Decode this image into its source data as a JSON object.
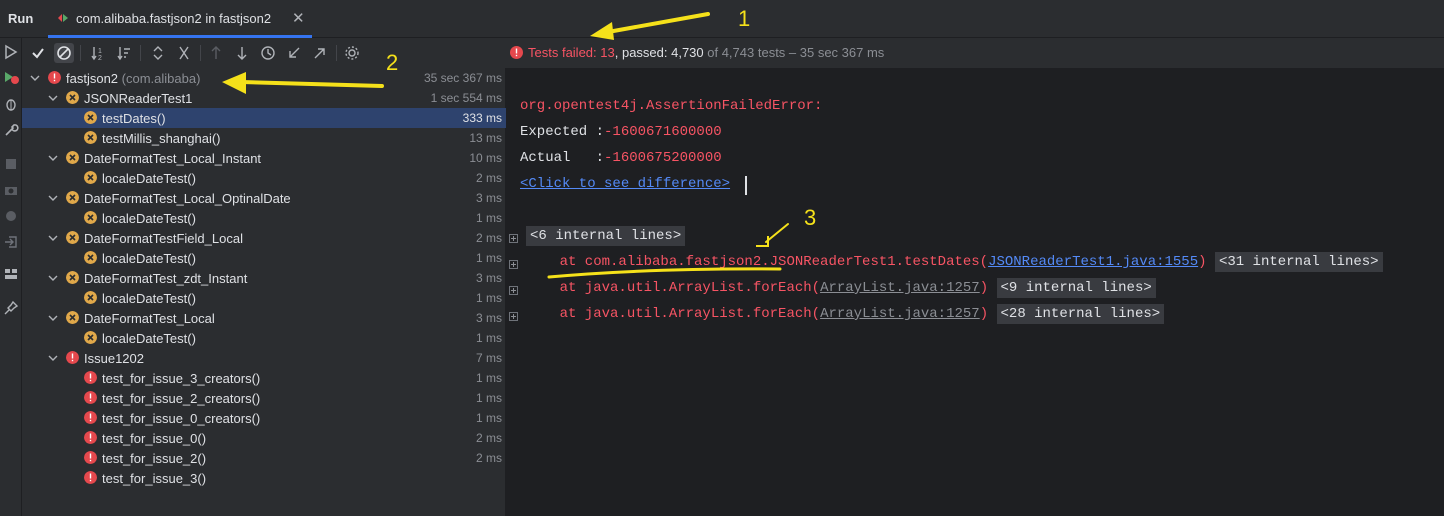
{
  "run_panel": {
    "title": "Run",
    "tab_label": "com.alibaba.fastjson2 in fastjson2"
  },
  "status": {
    "failed_label": "Tests failed: ",
    "failed_count": "13",
    "passed_label": ", passed: 4,730",
    "rest": " of 4,743 tests – 35 sec 367 ms"
  },
  "tree": [
    {
      "name": "fastjson2",
      "pkg": "(com.alibaba)",
      "time": "35 sec 367 ms",
      "status": "fail",
      "level": 0
    },
    {
      "name": "JSONReaderTest1",
      "time": "1 sec 554 ms",
      "status": "warn",
      "level": 1
    },
    {
      "name": "testDates()",
      "time": "333 ms",
      "status": "warn",
      "level": 2,
      "selected": true
    },
    {
      "name": "testMillis_shanghai()",
      "time": "13 ms",
      "status": "warn",
      "level": 2
    },
    {
      "name": "DateFormatTest_Local_Instant",
      "time": "10 ms",
      "status": "warn",
      "level": 1
    },
    {
      "name": "localeDateTest()",
      "time": "2 ms",
      "status": "warn",
      "level": 2
    },
    {
      "name": "DateFormatTest_Local_OptinalDate",
      "time": "3 ms",
      "status": "warn",
      "level": 1
    },
    {
      "name": "localeDateTest()",
      "time": "1 ms",
      "status": "warn",
      "level": 2
    },
    {
      "name": "DateFormatTestField_Local",
      "time": "2 ms",
      "status": "warn",
      "level": 1
    },
    {
      "name": "localeDateTest()",
      "time": "1 ms",
      "status": "warn",
      "level": 2
    },
    {
      "name": "DateFormatTest_zdt_Instant",
      "time": "3 ms",
      "status": "warn",
      "level": 1
    },
    {
      "name": "localeDateTest()",
      "time": "1 ms",
      "status": "warn",
      "level": 2
    },
    {
      "name": "DateFormatTest_Local",
      "time": "3 ms",
      "status": "warn",
      "level": 1
    },
    {
      "name": "localeDateTest()",
      "time": "1 ms",
      "status": "warn",
      "level": 2
    },
    {
      "name": "Issue1202",
      "time": "7 ms",
      "status": "fail",
      "level": 1
    },
    {
      "name": "test_for_issue_3_creators()",
      "time": "1 ms",
      "status": "fail",
      "level": 2
    },
    {
      "name": "test_for_issue_2_creators()",
      "time": "1 ms",
      "status": "fail",
      "level": 2
    },
    {
      "name": "test_for_issue_0_creators()",
      "time": "1 ms",
      "status": "fail",
      "level": 2
    },
    {
      "name": "test_for_issue_0()",
      "time": "2 ms",
      "status": "fail",
      "level": 2
    },
    {
      "name": "test_for_issue_2()",
      "time": "2 ms",
      "status": "fail",
      "level": 2
    },
    {
      "name": "test_for_issue_3()",
      "time": "",
      "status": "fail",
      "level": 2
    }
  ],
  "console": {
    "error": "org.opentest4j.AssertionFailedError:",
    "expected_label": "Expected :",
    "expected_value": "-1600671600000",
    "actual_label": "Actual   :",
    "actual_value": "-1600675200000",
    "diff_link": "<Click to see difference>",
    "internal_6": "<6 internal lines>",
    "st1_prefix": "    at com.alibaba.fastjson2.JSONReaderTest1.testDates(",
    "st1_link": "JSONReaderTest1.java:1555",
    "st1_suffix": ")",
    "internal_31": "<31 internal lines>",
    "st2_prefix": "    at java.util.ArrayList.forEach(",
    "st2_link": "ArrayList.java:1257",
    "st2_suffix": ")",
    "internal_9": "<9 internal lines>",
    "st3_prefix": "    at java.util.ArrayList.forEach(",
    "st3_link": "ArrayList.java:1257",
    "st3_suffix": ")",
    "internal_28": "<28 internal lines>"
  },
  "annotations": {
    "one": "1",
    "two": "2",
    "three": "3"
  },
  "colors": {
    "accent": "#3574f0",
    "fail": "#e5484d",
    "warn": "#e0a84a",
    "annotation": "#f5e11a"
  }
}
